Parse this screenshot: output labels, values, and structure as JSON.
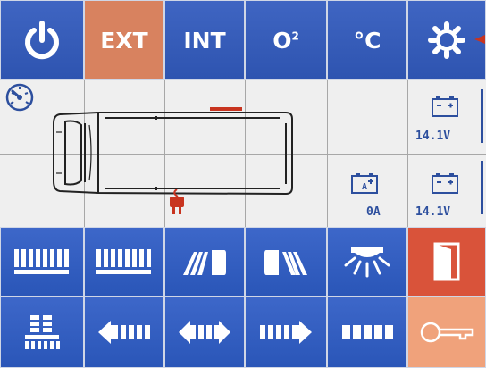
{
  "top_bar": {
    "power_icon": "power-icon",
    "ext_label": "EXT",
    "int_label": "INT",
    "o2_label": "O",
    "o2_superscript": "2",
    "temp_label": "°C",
    "settings_icon": "gear-icon"
  },
  "status": {
    "speedometer_icon": "speedometer-icon",
    "battery_1_voltage": "14.1V",
    "battery_2_voltage": "14.1V",
    "charger_current": "0A"
  },
  "controls": {
    "row1": [
      "roof-lights-1-icon",
      "roof-lights-2-icon",
      "flood-left-icon",
      "flood-right-icon",
      "ceiling-light-icon",
      "door-icon"
    ],
    "row2": [
      "light-grid-icon",
      "arrow-left-icon",
      "arrow-both-icon",
      "arrow-right-icon",
      "light-bar-icon",
      "key-icon"
    ]
  },
  "colors": {
    "blue": "#2e54b0",
    "ext_active": "#d8825f",
    "door_red": "#d9533a",
    "key_peach": "#f0a27b",
    "voltage_text": "#2d4f9e",
    "alert_red": "#c8341f"
  }
}
